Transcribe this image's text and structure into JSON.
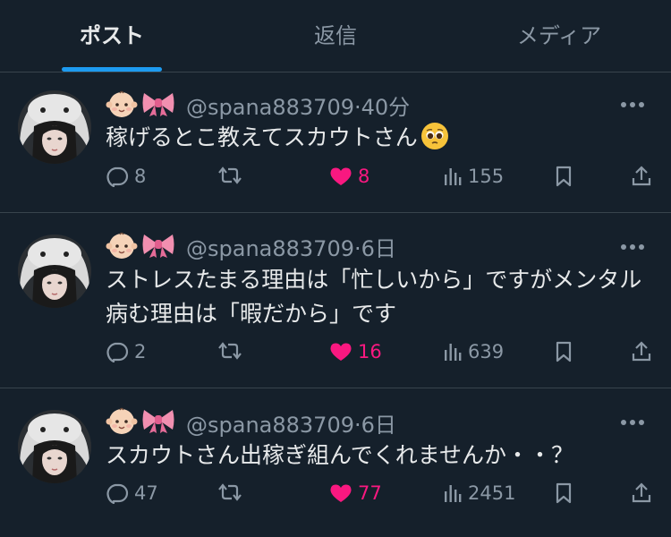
{
  "tabs": [
    {
      "label": "ポスト",
      "active": true
    },
    {
      "label": "返信",
      "active": false
    },
    {
      "label": "メディア",
      "active": false
    }
  ],
  "colors": {
    "background": "#15202b",
    "accent": "#1d9bf0",
    "like": "#f91880",
    "muted": "#8b98a5",
    "divider": "#38444d"
  },
  "posts": [
    {
      "handle": "@spana883709",
      "time": "40分",
      "text": "稼げるとこ教えてスカウトさん",
      "emoji": "pleading-face",
      "replies": "8",
      "likes": "8",
      "views": "155",
      "liked": true
    },
    {
      "handle": "@spana883709",
      "time": "6日",
      "text": "ストレスたまる理由は「忙しいから」ですがメンタル病む理由は「暇だから」です",
      "replies": "2",
      "likes": "16",
      "views": "639",
      "liked": true
    },
    {
      "handle": "@spana883709",
      "time": "6日",
      "text": "スカウトさん出稼ぎ組んでくれませんか・・？",
      "replies": "47",
      "likes": "77",
      "views": "2451",
      "liked": true
    }
  ],
  "icons": {
    "name_decorations": [
      "baby-emoji",
      "ribbon-emoji"
    ],
    "actions": [
      "reply-icon",
      "repost-icon",
      "like-icon",
      "views-icon",
      "bookmark-icon",
      "share-icon"
    ]
  },
  "separator": "·"
}
